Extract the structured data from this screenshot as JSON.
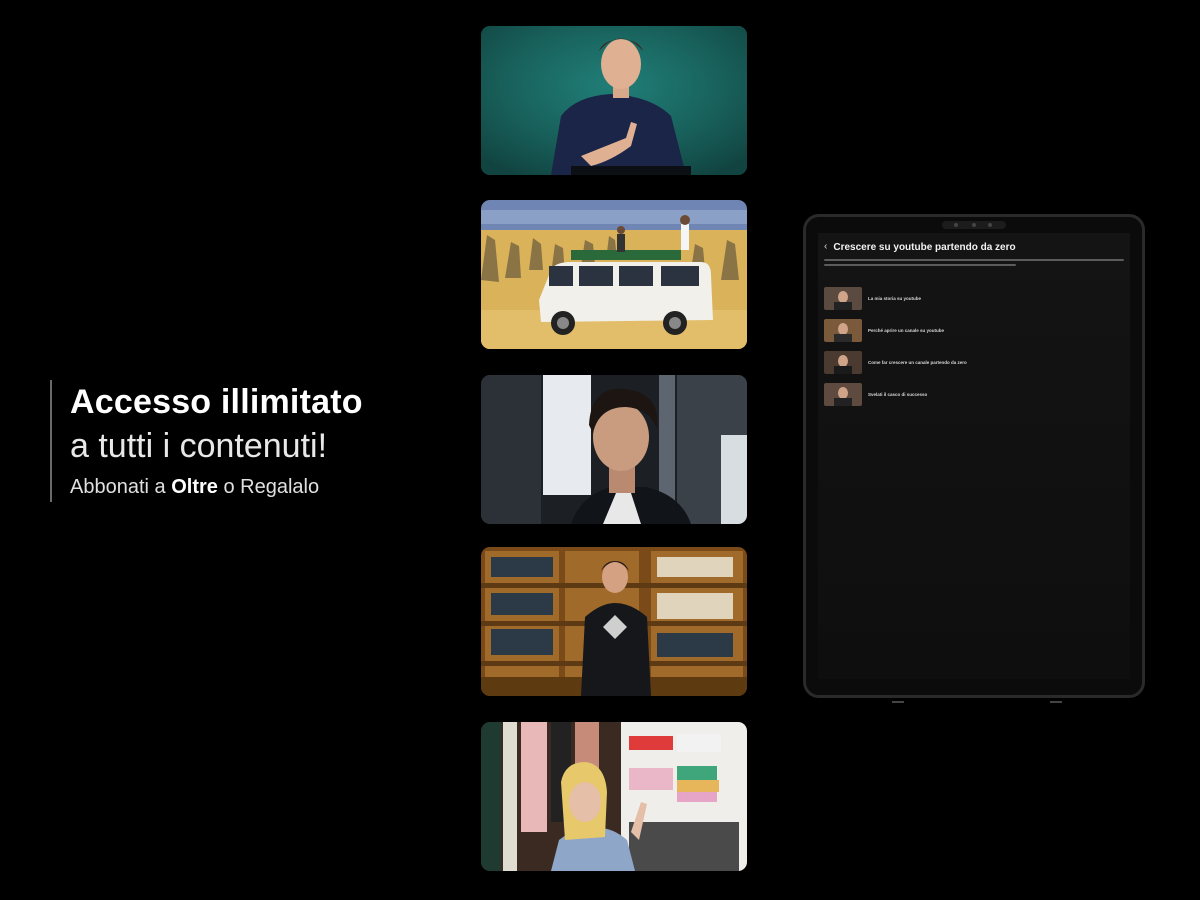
{
  "promo": {
    "headline": "Accesso illimitato",
    "subheadline": "a tutti i contenuti!",
    "cta_prefix": "Abbonati a ",
    "cta_brand": "Oltre",
    "cta_suffix": " o Regalalo"
  },
  "cards": [
    {
      "icon": "man-teal-background-photo"
    },
    {
      "icon": "van-desert-photo"
    },
    {
      "icon": "man-portrait-photo"
    },
    {
      "icon": "man-bookshelf-photo"
    },
    {
      "icon": "woman-wardrobe-photo"
    }
  ],
  "tablet": {
    "back_icon": "‹",
    "title": "Crescere su youtube partendo da zero",
    "episodes": [
      {
        "label": "La mia storia su youtube"
      },
      {
        "label": "Perché aprire un canale su youtube"
      },
      {
        "label": "Come far crescere un canale partendo da zero"
      },
      {
        "label": "Svelati il casco di successo"
      }
    ]
  },
  "colors": {
    "background": "#000000",
    "teal": "#1c6b66",
    "sand": "#d9b25a",
    "wood": "#a06a2a"
  }
}
